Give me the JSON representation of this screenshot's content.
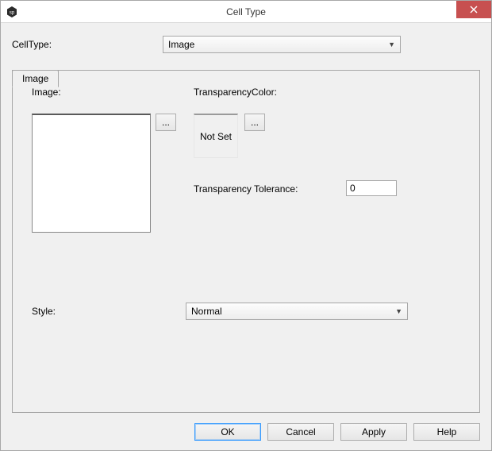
{
  "window": {
    "title": "Cell Type"
  },
  "celltype": {
    "label": "CellType:",
    "selected": "Image"
  },
  "tabs": {
    "image": "Image"
  },
  "panel": {
    "image_label": "Image:",
    "browse_label": "...",
    "transparency_label": "TransparencyColor:",
    "notset_label": "Not Set",
    "trans_browse_label": "...",
    "tolerance_label": "Transparency Tolerance:",
    "tolerance_value": "0",
    "style_label": "Style:",
    "style_selected": "Normal"
  },
  "buttons": {
    "ok": "OK",
    "cancel": "Cancel",
    "apply": "Apply",
    "help": "Help"
  }
}
